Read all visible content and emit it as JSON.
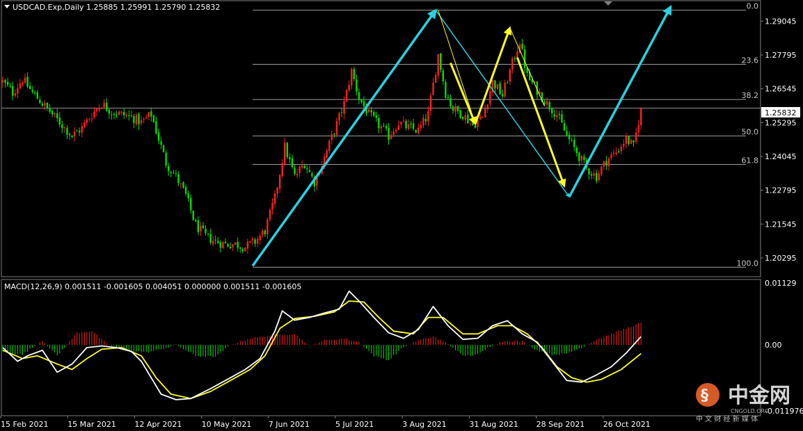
{
  "header": {
    "symbol_line": "USDCAD.Exp,Daily  1.25885 1.25991 1.25790 1.25832",
    "macd_line": "MACD(12,26,9) 0.001511 -0.001605 0.004051 0.000000 0.001511 -0.001605"
  },
  "colors": {
    "bull_candle": "#ff2020",
    "bear_candle": "#00e000",
    "wave_cyan": "#2ad0e0",
    "wave_yellow": "#ffff20",
    "macd_line": "#ffffff",
    "signal_line": "#ffff20",
    "fib_line": "#a0a0a0"
  },
  "chart_data": [
    {
      "type": "candlestick",
      "title": "USDCAD.Exp,Daily",
      "ylim": [
        1.196,
        1.298
      ],
      "y_ticks": [
        "1.29045",
        "1.27795",
        "1.26545",
        "1.25295",
        "1.24045",
        "1.22795",
        "1.21545",
        "1.20295"
      ],
      "current_price": "1.25832",
      "x_ticks": [
        "15 Feb 2021",
        "15 Mar 2021",
        "12 Apr 2021",
        "10 May 2021",
        "7 Jun 2021",
        "5 Jul 2021",
        "3 Aug 2021",
        "31 Aug 2021",
        "28 Sep 2021",
        "26 Oct 2021"
      ],
      "close_path": [
        {
          "day": 0,
          "close": 1.268
        },
        {
          "day": 4,
          "close": 1.264
        },
        {
          "day": 8,
          "close": 1.269
        },
        {
          "day": 12,
          "close": 1.264
        },
        {
          "day": 16,
          "close": 1.26
        },
        {
          "day": 20,
          "close": 1.256
        },
        {
          "day": 24,
          "close": 1.252
        },
        {
          "day": 28,
          "close": 1.248
        },
        {
          "day": 32,
          "close": 1.251
        },
        {
          "day": 36,
          "close": 1.256
        },
        {
          "day": 40,
          "close": 1.26
        },
        {
          "day": 44,
          "close": 1.257
        },
        {
          "day": 48,
          "close": 1.256
        },
        {
          "day": 52,
          "close": 1.255
        },
        {
          "day": 56,
          "close": 1.253
        },
        {
          "day": 60,
          "close": 1.256
        },
        {
          "day": 62,
          "close": 1.25
        },
        {
          "day": 66,
          "close": 1.238
        },
        {
          "day": 70,
          "close": 1.233
        },
        {
          "day": 74,
          "close": 1.226
        },
        {
          "day": 78,
          "close": 1.215
        },
        {
          "day": 82,
          "close": 1.211
        },
        {
          "day": 86,
          "close": 1.209
        },
        {
          "day": 90,
          "close": 1.208
        },
        {
          "day": 94,
          "close": 1.208
        },
        {
          "day": 98,
          "close": 1.207
        },
        {
          "day": 102,
          "close": 1.209
        },
        {
          "day": 106,
          "close": 1.213
        },
        {
          "day": 110,
          "close": 1.225
        },
        {
          "day": 114,
          "close": 1.244
        },
        {
          "day": 118,
          "close": 1.233
        },
        {
          "day": 122,
          "close": 1.238
        },
        {
          "day": 126,
          "close": 1.231
        },
        {
          "day": 130,
          "close": 1.24
        },
        {
          "day": 134,
          "close": 1.25
        },
        {
          "day": 138,
          "close": 1.26
        },
        {
          "day": 141,
          "close": 1.272
        },
        {
          "day": 144,
          "close": 1.262
        },
        {
          "day": 148,
          "close": 1.256
        },
        {
          "day": 152,
          "close": 1.252
        },
        {
          "day": 156,
          "close": 1.248
        },
        {
          "day": 160,
          "close": 1.253
        },
        {
          "day": 164,
          "close": 1.251
        },
        {
          "day": 168,
          "close": 1.25
        },
        {
          "day": 172,
          "close": 1.256
        },
        {
          "day": 176,
          "close": 1.278
        },
        {
          "day": 179,
          "close": 1.264
        },
        {
          "day": 182,
          "close": 1.258
        },
        {
          "day": 186,
          "close": 1.256
        },
        {
          "day": 190,
          "close": 1.252
        },
        {
          "day": 194,
          "close": 1.255
        },
        {
          "day": 198,
          "close": 1.268
        },
        {
          "day": 202,
          "close": 1.263
        },
        {
          "day": 206,
          "close": 1.275
        },
        {
          "day": 209,
          "close": 1.283
        },
        {
          "day": 212,
          "close": 1.27
        },
        {
          "day": 216,
          "close": 1.265
        },
        {
          "day": 220,
          "close": 1.26
        },
        {
          "day": 224,
          "close": 1.256
        },
        {
          "day": 228,
          "close": 1.248
        },
        {
          "day": 232,
          "close": 1.242
        },
        {
          "day": 236,
          "close": 1.236
        },
        {
          "day": 240,
          "close": 1.233
        },
        {
          "day": 244,
          "close": 1.239
        },
        {
          "day": 248,
          "close": 1.242
        },
        {
          "day": 252,
          "close": 1.247
        },
        {
          "day": 255,
          "close": 1.244
        },
        {
          "day": 258,
          "close": 1.2583
        }
      ],
      "fibonacci": {
        "levels": [
          {
            "label": "0.0",
            "price": 1.2945
          },
          {
            "label": "23.6",
            "price": 1.2745
          },
          {
            "label": "38.2",
            "price": 1.2615
          },
          {
            "label": "50.0",
            "price": 1.248
          },
          {
            "label": "61.8",
            "price": 1.2375
          },
          {
            "label": "100.0",
            "price": 1.1995
          }
        ]
      },
      "wave_lines": {
        "cyan_arrows": [
          [
            {
              "day": 101,
              "price": 1.2
            },
            {
              "day": 175,
              "price": 1.2945
            }
          ],
          [
            {
              "day": 229,
              "price": 1.2255
            },
            {
              "day": 270,
              "price": 1.2958
            }
          ]
        ],
        "cyan_lines": [
          [
            {
              "day": 175,
              "price": 1.2945
            },
            {
              "day": 229,
              "price": 1.2255
            }
          ]
        ],
        "yellow_arrows": [
          [
            {
              "day": 181,
              "price": 1.275
            },
            {
              "day": 191,
              "price": 1.2525
            }
          ],
          [
            {
              "day": 191,
              "price": 1.2525
            },
            {
              "day": 205,
              "price": 1.288
            }
          ],
          [
            {
              "day": 208,
              "price": 1.277
            },
            {
              "day": 227,
              "price": 1.2295
            }
          ]
        ],
        "yellow_thin": [
          [
            {
              "day": 176,
              "price": 1.2945
            },
            {
              "day": 191,
              "price": 1.2525
            }
          ],
          [
            {
              "day": 205,
              "price": 1.288
            },
            {
              "day": 219,
              "price": 1.259
            }
          ]
        ]
      }
    },
    {
      "type": "line",
      "title": "MACD(12,26,9)",
      "ylim": [
        -0.0128,
        0.0118
      ],
      "y_ticks": [
        "0.01129",
        "0.00",
        "-0.011976"
      ],
      "histogram": [
        {
          "day": 0,
          "value": -0.0012
        },
        {
          "day": 8,
          "value": -0.0018
        },
        {
          "day": 16,
          "value": 0.0008
        },
        {
          "day": 22,
          "value": -0.002
        },
        {
          "day": 30,
          "value": 0.0022
        },
        {
          "day": 36,
          "value": 0.0025
        },
        {
          "day": 42,
          "value": 0.0002
        },
        {
          "day": 50,
          "value": -0.001
        },
        {
          "day": 58,
          "value": -0.0014
        },
        {
          "day": 64,
          "value": -0.0008
        },
        {
          "day": 70,
          "value": 0.0
        },
        {
          "day": 78,
          "value": -0.002
        },
        {
          "day": 86,
          "value": -0.0022
        },
        {
          "day": 92,
          "value": 0.0
        },
        {
          "day": 100,
          "value": 0.0012
        },
        {
          "day": 110,
          "value": 0.0018
        },
        {
          "day": 118,
          "value": 0.002
        },
        {
          "day": 124,
          "value": -0.0002
        },
        {
          "day": 130,
          "value": 0.0008
        },
        {
          "day": 138,
          "value": 0.0012
        },
        {
          "day": 144,
          "value": 0.0005
        },
        {
          "day": 150,
          "value": -0.002
        },
        {
          "day": 156,
          "value": -0.0028
        },
        {
          "day": 162,
          "value": -0.0004
        },
        {
          "day": 168,
          "value": 0.0008
        },
        {
          "day": 174,
          "value": 0.0015
        },
        {
          "day": 180,
          "value": 0.0002
        },
        {
          "day": 186,
          "value": -0.002
        },
        {
          "day": 192,
          "value": -0.0018
        },
        {
          "day": 198,
          "value": 0.0
        },
        {
          "day": 204,
          "value": 0.0008
        },
        {
          "day": 210,
          "value": 0.0006
        },
        {
          "day": 216,
          "value": -0.001
        },
        {
          "day": 222,
          "value": -0.0018
        },
        {
          "day": 228,
          "value": -0.0016
        },
        {
          "day": 234,
          "value": -0.0005
        },
        {
          "day": 240,
          "value": 0.001
        },
        {
          "day": 246,
          "value": 0.002
        },
        {
          "day": 252,
          "value": 0.003
        },
        {
          "day": 258,
          "value": 0.004
        }
      ],
      "series": [
        {
          "values": [
            {
              "day": 0,
              "value": -0.0005
            },
            {
              "day": 6,
              "value": -0.003
            },
            {
              "day": 10,
              "value": -0.002
            },
            {
              "day": 16,
              "value": -0.001
            },
            {
              "day": 22,
              "value": -0.005
            },
            {
              "day": 28,
              "value": -0.0035
            },
            {
              "day": 34,
              "value": -0.0005
            },
            {
              "day": 40,
              "value": -0.0002
            },
            {
              "day": 46,
              "value": -0.0005
            },
            {
              "day": 52,
              "value": -0.0012
            },
            {
              "day": 56,
              "value": -0.003
            },
            {
              "day": 60,
              "value": -0.006
            },
            {
              "day": 64,
              "value": -0.009
            },
            {
              "day": 70,
              "value": -0.01
            },
            {
              "day": 76,
              "value": -0.0098
            },
            {
              "day": 84,
              "value": -0.008
            },
            {
              "day": 92,
              "value": -0.006
            },
            {
              "day": 98,
              "value": -0.0045
            },
            {
              "day": 104,
              "value": -0.0025
            },
            {
              "day": 110,
              "value": 0.0025
            },
            {
              "day": 113,
              "value": 0.0062
            },
            {
              "day": 118,
              "value": 0.0045
            },
            {
              "day": 124,
              "value": 0.005
            },
            {
              "day": 130,
              "value": 0.0058
            },
            {
              "day": 136,
              "value": 0.0065
            },
            {
              "day": 140,
              "value": 0.0098
            },
            {
              "day": 144,
              "value": 0.008
            },
            {
              "day": 150,
              "value": 0.005
            },
            {
              "day": 156,
              "value": 0.0022
            },
            {
              "day": 162,
              "value": 0.0012
            },
            {
              "day": 168,
              "value": 0.0028
            },
            {
              "day": 174,
              "value": 0.007
            },
            {
              "day": 180,
              "value": 0.0035
            },
            {
              "day": 186,
              "value": 0.001
            },
            {
              "day": 192,
              "value": 0.0012
            },
            {
              "day": 198,
              "value": 0.0035
            },
            {
              "day": 204,
              "value": 0.0044
            },
            {
              "day": 210,
              "value": 0.002
            },
            {
              "day": 216,
              "value": 0.0005
            },
            {
              "day": 222,
              "value": -0.003
            },
            {
              "day": 228,
              "value": -0.0065
            },
            {
              "day": 234,
              "value": -0.0068
            },
            {
              "day": 240,
              "value": -0.0055
            },
            {
              "day": 246,
              "value": -0.004
            },
            {
              "day": 252,
              "value": -0.0015
            },
            {
              "day": 258,
              "value": 0.0015
            }
          ]
        },
        {
          "values": [
            {
              "day": 0,
              "value": -0.001
            },
            {
              "day": 8,
              "value": -0.0025
            },
            {
              "day": 14,
              "value": -0.002
            },
            {
              "day": 22,
              "value": -0.0035
            },
            {
              "day": 28,
              "value": -0.0045
            },
            {
              "day": 34,
              "value": -0.0025
            },
            {
              "day": 40,
              "value": -0.0008
            },
            {
              "day": 48,
              "value": -0.0005
            },
            {
              "day": 56,
              "value": -0.002
            },
            {
              "day": 62,
              "value": -0.006
            },
            {
              "day": 68,
              "value": -0.009
            },
            {
              "day": 76,
              "value": -0.0098
            },
            {
              "day": 84,
              "value": -0.0085
            },
            {
              "day": 92,
              "value": -0.0065
            },
            {
              "day": 100,
              "value": -0.0045
            },
            {
              "day": 106,
              "value": -0.002
            },
            {
              "day": 112,
              "value": 0.003
            },
            {
              "day": 118,
              "value": 0.0048
            },
            {
              "day": 126,
              "value": 0.0052
            },
            {
              "day": 134,
              "value": 0.006
            },
            {
              "day": 140,
              "value": 0.008
            },
            {
              "day": 146,
              "value": 0.0078
            },
            {
              "day": 152,
              "value": 0.005
            },
            {
              "day": 158,
              "value": 0.0025
            },
            {
              "day": 166,
              "value": 0.002
            },
            {
              "day": 172,
              "value": 0.005
            },
            {
              "day": 178,
              "value": 0.005
            },
            {
              "day": 186,
              "value": 0.002
            },
            {
              "day": 192,
              "value": 0.002
            },
            {
              "day": 200,
              "value": 0.0035
            },
            {
              "day": 206,
              "value": 0.0035
            },
            {
              "day": 212,
              "value": 0.002
            },
            {
              "day": 218,
              "value": -0.0005
            },
            {
              "day": 224,
              "value": -0.004
            },
            {
              "day": 230,
              "value": -0.006
            },
            {
              "day": 236,
              "value": -0.0068
            },
            {
              "day": 242,
              "value": -0.0063
            },
            {
              "day": 250,
              "value": -0.0045
            },
            {
              "day": 258,
              "value": -0.0016
            }
          ]
        }
      ]
    }
  ],
  "watermark": {
    "brand": "中金网",
    "domain": "CNGOLD.ORG",
    "slogan": "中 文 财 经 新 媒 体"
  }
}
